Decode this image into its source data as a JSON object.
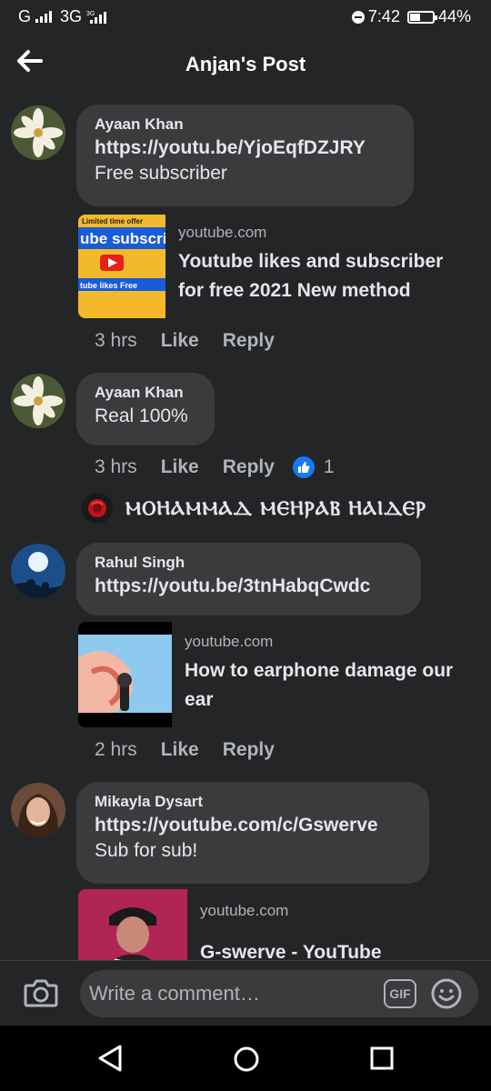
{
  "status_bar": {
    "network_left": "G",
    "network_mid": "3G",
    "time": "7:42",
    "battery_level": 0.44,
    "battery_text": "44%"
  },
  "header": {
    "title": "Anjan's Post",
    "back_icon": "arrow-left-icon"
  },
  "comments": [
    {
      "author": "Ayaan Khan",
      "link": "https://youtu.be/YjoEqfDZJRY",
      "text": "Free subscriber",
      "preview": {
        "domain": "youtube.com",
        "title": "Youtube likes and subscriber for free 2021 New method",
        "thumb_top": "Limited time offer",
        "thumb_mid": "ube subscribe",
        "thumb_bottom": "tube likes Free"
      },
      "time": "3 hrs",
      "like_label": "Like",
      "reply_label": "Reply"
    },
    {
      "author": "Ayaan Khan",
      "text": "Real 100%",
      "time": "3 hrs",
      "like_label": "Like",
      "reply_label": "Reply",
      "reaction_count": "1"
    },
    {
      "author": "Rahul Singh",
      "link": "https://youtu.be/3tnHabqCwdc",
      "preview": {
        "domain": "youtube.com",
        "title": "How to earphone damage our ear"
      },
      "time": "2 hrs",
      "like_label": "Like",
      "reply_label": "Reply"
    },
    {
      "author": "Mikayla Dysart",
      "link": "https://youtube.com/c/Gswerve",
      "text": "Sub for sub!",
      "preview": {
        "domain": "youtube.com",
        "title": "G-swerve - YouTube"
      }
    }
  ],
  "reply_preview": {
    "author": "ⲘⲞⲎⲀⲘⲘⲀⲆ ⲘⲈⲎⲢⲀⲂ ⲎⲀⲒⲆⲈⲢ"
  },
  "composer": {
    "placeholder": "Write a comment…",
    "gif_label": "GIF",
    "camera_icon": "camera-icon",
    "emoji_icon": "smiley-icon"
  },
  "colors": {
    "background": "#242526",
    "bubble": "#3a3b3c",
    "secondary_text": "#b0b3b8",
    "like_blue": "#1877f2"
  }
}
